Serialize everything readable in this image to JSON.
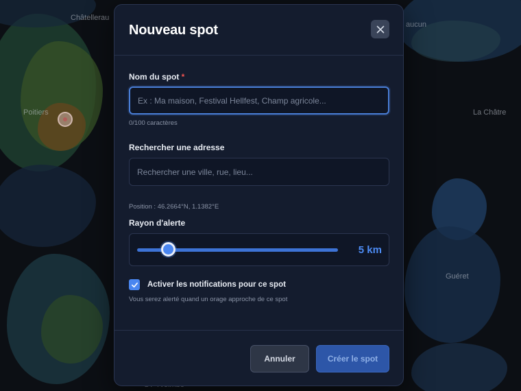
{
  "map": {
    "labels": {
      "chatellerault": "Châtellerau",
      "poitiers": "Poitiers",
      "la_chatre": "La Châtre",
      "gueret": "Guéret",
      "top_right": "aucun",
      "bottom": "ST Yvoimbe"
    }
  },
  "modal": {
    "title": "Nouveau spot",
    "close_label": "Fermer"
  },
  "spot_name": {
    "label": "Nom du spot",
    "required_mark": "*",
    "value": "",
    "placeholder": "Ex : Ma maison, Festival Hellfest, Champ agricole...",
    "char_count": "0/100 caractères"
  },
  "address": {
    "label": "Rechercher une adresse",
    "value": "",
    "placeholder": "Rechercher une ville, rue, lieu...",
    "position_text": "Position : 46.2664°N, 1.1382°E"
  },
  "radius": {
    "label": "Rayon d'alerte",
    "value": 5,
    "min": 1,
    "max": 50,
    "display": "5 km"
  },
  "notifications": {
    "checked": true,
    "label": "Activer les notifications pour ce spot",
    "hint": "Vous serez alerté quand un orage approche de ce spot"
  },
  "footer": {
    "cancel_label": "Annuler",
    "create_label": "Créer le spot"
  },
  "colors": {
    "accent": "#4a86f0",
    "modal_bg": "#141c2e",
    "required": "#ef5350"
  }
}
